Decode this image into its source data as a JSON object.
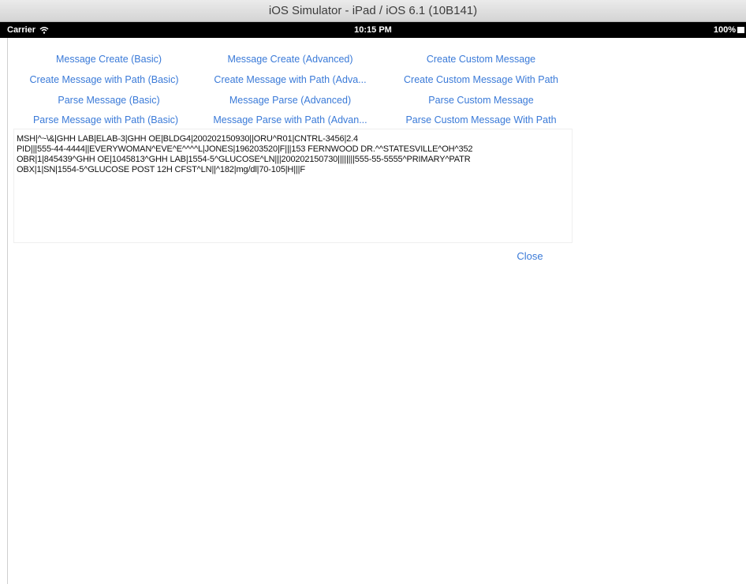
{
  "window": {
    "title": "iOS Simulator - iPad / iOS 6.1 (10B141)"
  },
  "statusbar": {
    "carrier": "Carrier",
    "time": "10:15 PM",
    "battery": "100%"
  },
  "buttons": {
    "row1": {
      "col1": "Message Create (Basic)",
      "col2": "Message Create (Advanced)",
      "col3": "Create Custom Message"
    },
    "row2": {
      "col1": "Create Message with Path (Basic)",
      "col2": "Create Message with Path (Adva...",
      "col3": "Create Custom Message With Path"
    },
    "row3": {
      "col1": "Parse Message (Basic)",
      "col2": "Message Parse (Advanced)",
      "col3": "Parse Custom Message"
    },
    "row4": {
      "col1": "Parse Message with Path (Basic)",
      "col2": "Message Parse with Path (Advan...",
      "col3": "Parse Custom Message With Path"
    }
  },
  "textview": {
    "lines": [
      "MSH|^~\\&|GHH LAB|ELAB-3|GHH OE|BLDG4|200202150930||ORU^R01|CNTRL-3456|2.4",
      "PID|||555-44-4444||EVERYWOMAN^EVE^E^^^^L|JONES|196203520|F|||153 FERNWOOD DR.^^STATESVILLE^OH^352",
      "OBR|1|845439^GHH OE|1045813^GHH LAB|1554-5^GLUCOSE^LN|||200202150730||||||||555-55-5555^PRIMARY^PATR",
      "OBX|1|SN|1554-5^GLUCOSE POST 12H CFST^LN||^182|mg/dl|70-105|H|||F"
    ]
  },
  "close_label": "Close",
  "colors": {
    "link_blue": "#3a7ad8",
    "status_bar": "#000000"
  }
}
